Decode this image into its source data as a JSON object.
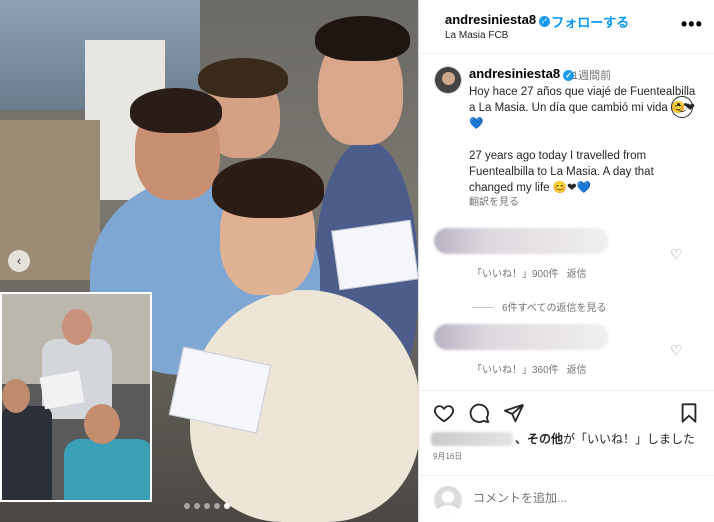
{
  "post": {
    "username": "andresiniesta8",
    "verified_mark": "✓",
    "follow_sep": "•",
    "follow_label": "フォローする",
    "location": "La Masia FCB",
    "more_label": "•••"
  },
  "caption": {
    "username": "andresiniesta8",
    "time": "1週間前",
    "text": "Hoy hace 27 años que viajé de Fuentealbilla a La Masia. Un día que cambió mi vida 😊❤💙\n\n27 years ago today I travelled from Fuentealbilla to La Masia. A day that changed my life 😊❤💙",
    "translate": "翻訳を見る"
  },
  "comments": [
    {
      "likes": "「いいね！」900件",
      "reply": "返信"
    },
    {
      "likes": "「いいね！」360件",
      "reply": "返信"
    }
  ],
  "view_replies": "6件すべての返信を見る",
  "likes_summary": {
    "others": "、その他",
    "suffix": "が「いいね！」しました"
  },
  "date": "9月16日",
  "comment_placeholder": "コメントを追加...",
  "icons": {
    "prev": "‹",
    "heart": "♡",
    "like": "heart-icon",
    "comment": "comment-icon",
    "share": "share-icon",
    "save": "bookmark-icon",
    "emoji": "emoji-icon"
  },
  "carousel": {
    "count": 5,
    "active": 4
  }
}
